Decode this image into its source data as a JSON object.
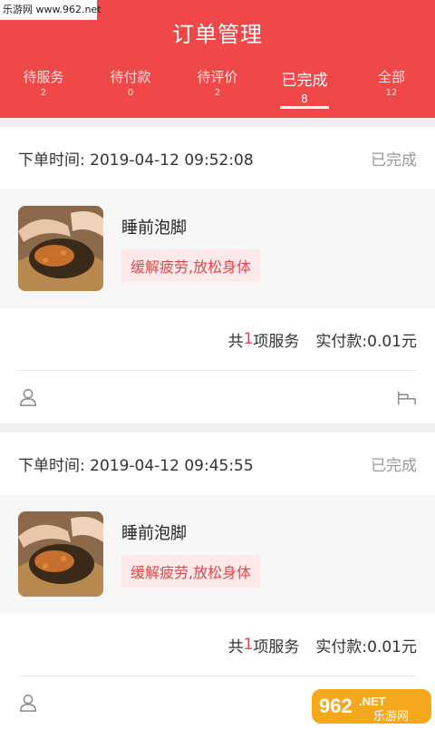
{
  "watermark": "乐游网 www.962.net",
  "header": {
    "title": "订单管理"
  },
  "tabs": [
    {
      "label": "待服务",
      "count": "2"
    },
    {
      "label": "待付款",
      "count": "0"
    },
    {
      "label": "待评价",
      "count": "2"
    },
    {
      "label": "已完成",
      "count": "8",
      "active": true
    },
    {
      "label": "全部",
      "count": "12"
    }
  ],
  "orders": [
    {
      "time_label": "下单时间:",
      "time": "2019-04-12 09:52:08",
      "status": "已完成",
      "item_name": "睡前泡脚",
      "item_tag": "缓解疲劳,放松身体",
      "summary_prefix": "共",
      "summary_count": "1",
      "summary_suffix": "项服务",
      "pay_label": "实付款:",
      "pay_amount": "0.01元"
    },
    {
      "time_label": "下单时间:",
      "time": "2019-04-12 09:45:55",
      "status": "已完成",
      "item_name": "睡前泡脚",
      "item_tag": "缓解疲劳,放松身体",
      "summary_prefix": "共",
      "summary_count": "1",
      "summary_suffix": "项服务",
      "pay_label": "实付款:",
      "pay_amount": "0.01元"
    }
  ],
  "icons": {
    "user": "user-icon",
    "bed": "bed-icon"
  },
  "colors": {
    "primary": "#f04848",
    "accent": "#e0494c",
    "tag_bg": "#fde9e9"
  },
  "badge": {
    "brand": "962",
    "tld": ".NET",
    "text": "乐游网"
  }
}
